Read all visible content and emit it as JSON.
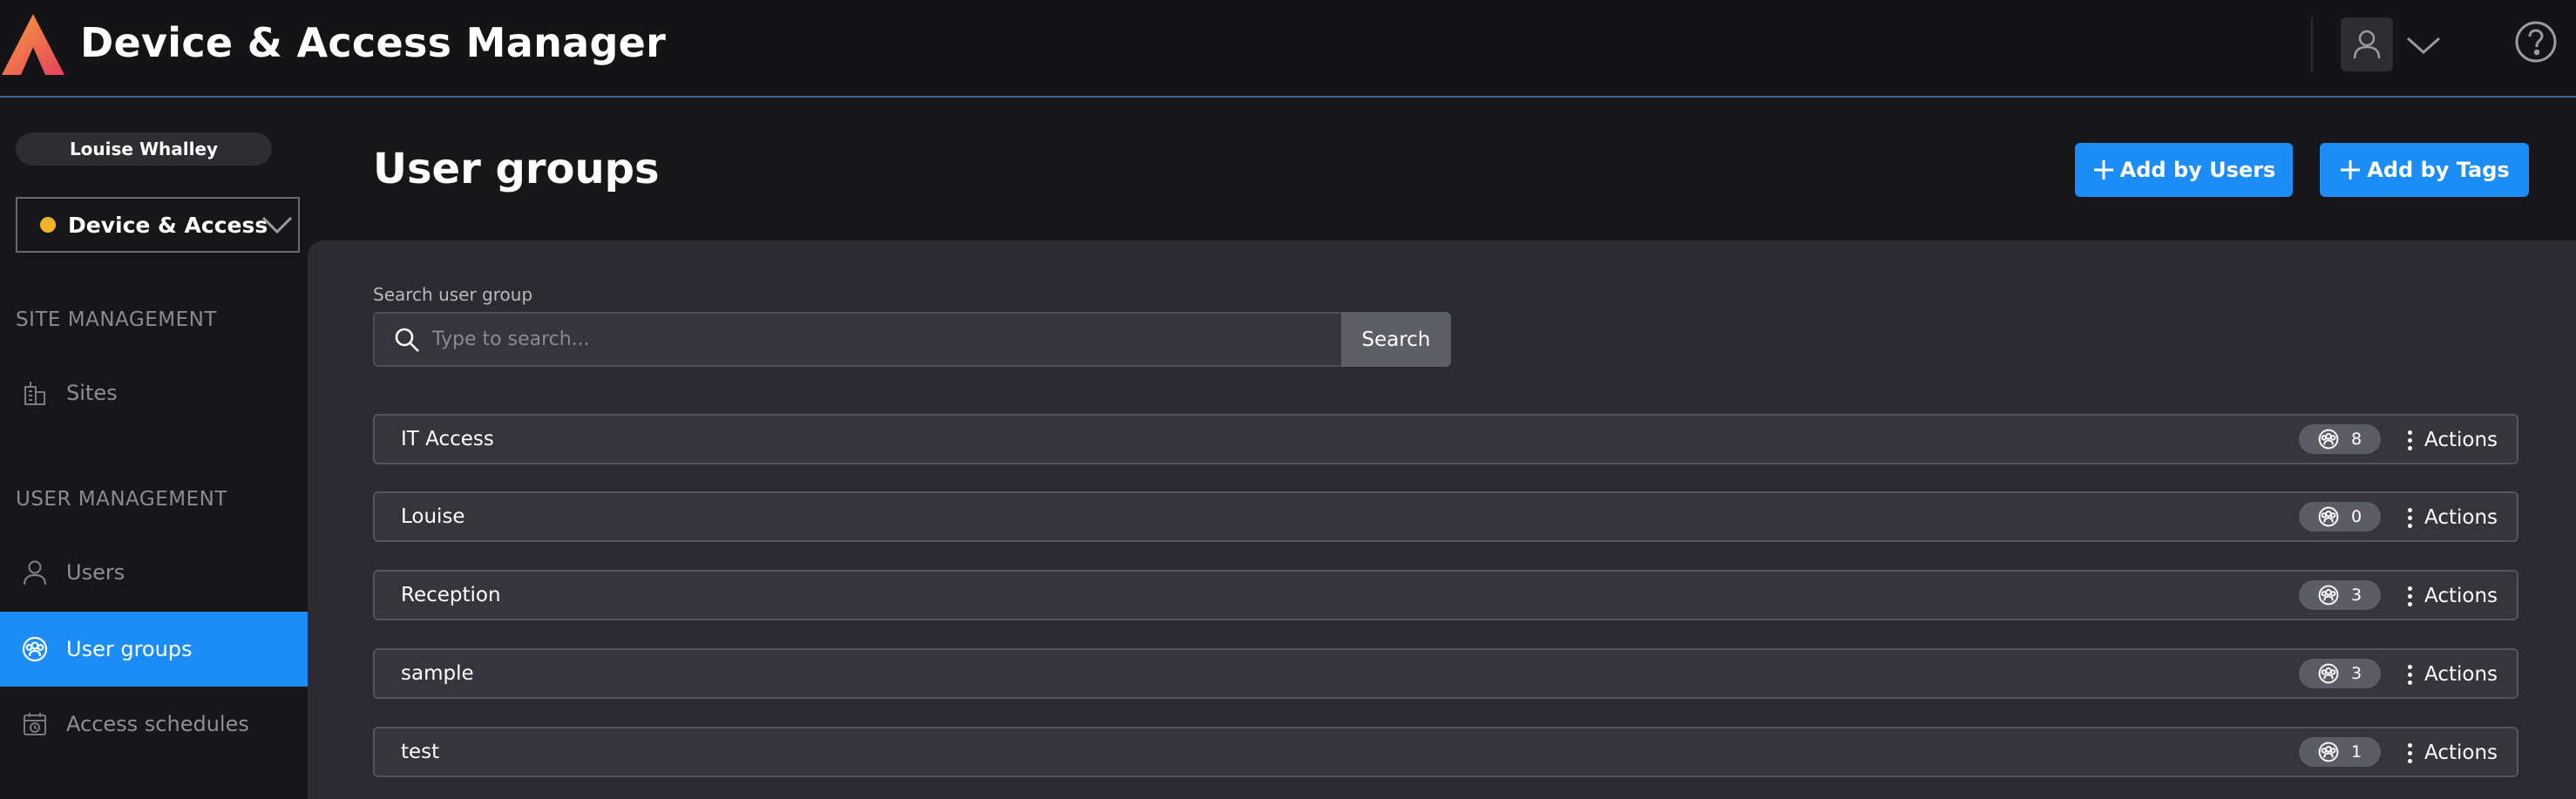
{
  "header": {
    "app_title": "Device & Access Manager",
    "accent_color": "#1c8cf7",
    "icons": [
      "logo",
      "user-avatar-icon",
      "chevron-down-icon",
      "help-icon"
    ]
  },
  "sidebar": {
    "user_name": "Louise Whalley",
    "context": {
      "label": "Device & Access",
      "status_color": "#f4b227"
    },
    "sections": [
      {
        "title": "SITE MANAGEMENT",
        "items": [
          {
            "label": "Sites",
            "icon": "building-icon",
            "active": false
          }
        ]
      },
      {
        "title": "USER MANAGEMENT",
        "items": [
          {
            "label": "Users",
            "icon": "user-icon",
            "active": false
          },
          {
            "label": "User groups",
            "icon": "user-group-icon",
            "active": true
          },
          {
            "label": "Access schedules",
            "icon": "schedule-icon",
            "active": false
          }
        ]
      }
    ]
  },
  "main": {
    "page_title": "User groups",
    "add_by_users_label": "Add by Users",
    "add_by_tags_label": "Add by Tags",
    "search": {
      "label": "Search user group",
      "placeholder": "Type to search...",
      "value": "",
      "button_label": "Search"
    },
    "groups": [
      {
        "name": "IT Access",
        "count": "8",
        "actions_label": "Actions"
      },
      {
        "name": "Louise",
        "count": "0",
        "actions_label": "Actions"
      },
      {
        "name": "Reception",
        "count": "3",
        "actions_label": "Actions"
      },
      {
        "name": "sample",
        "count": "3",
        "actions_label": "Actions"
      },
      {
        "name": "test",
        "count": "1",
        "actions_label": "Actions"
      }
    ]
  }
}
